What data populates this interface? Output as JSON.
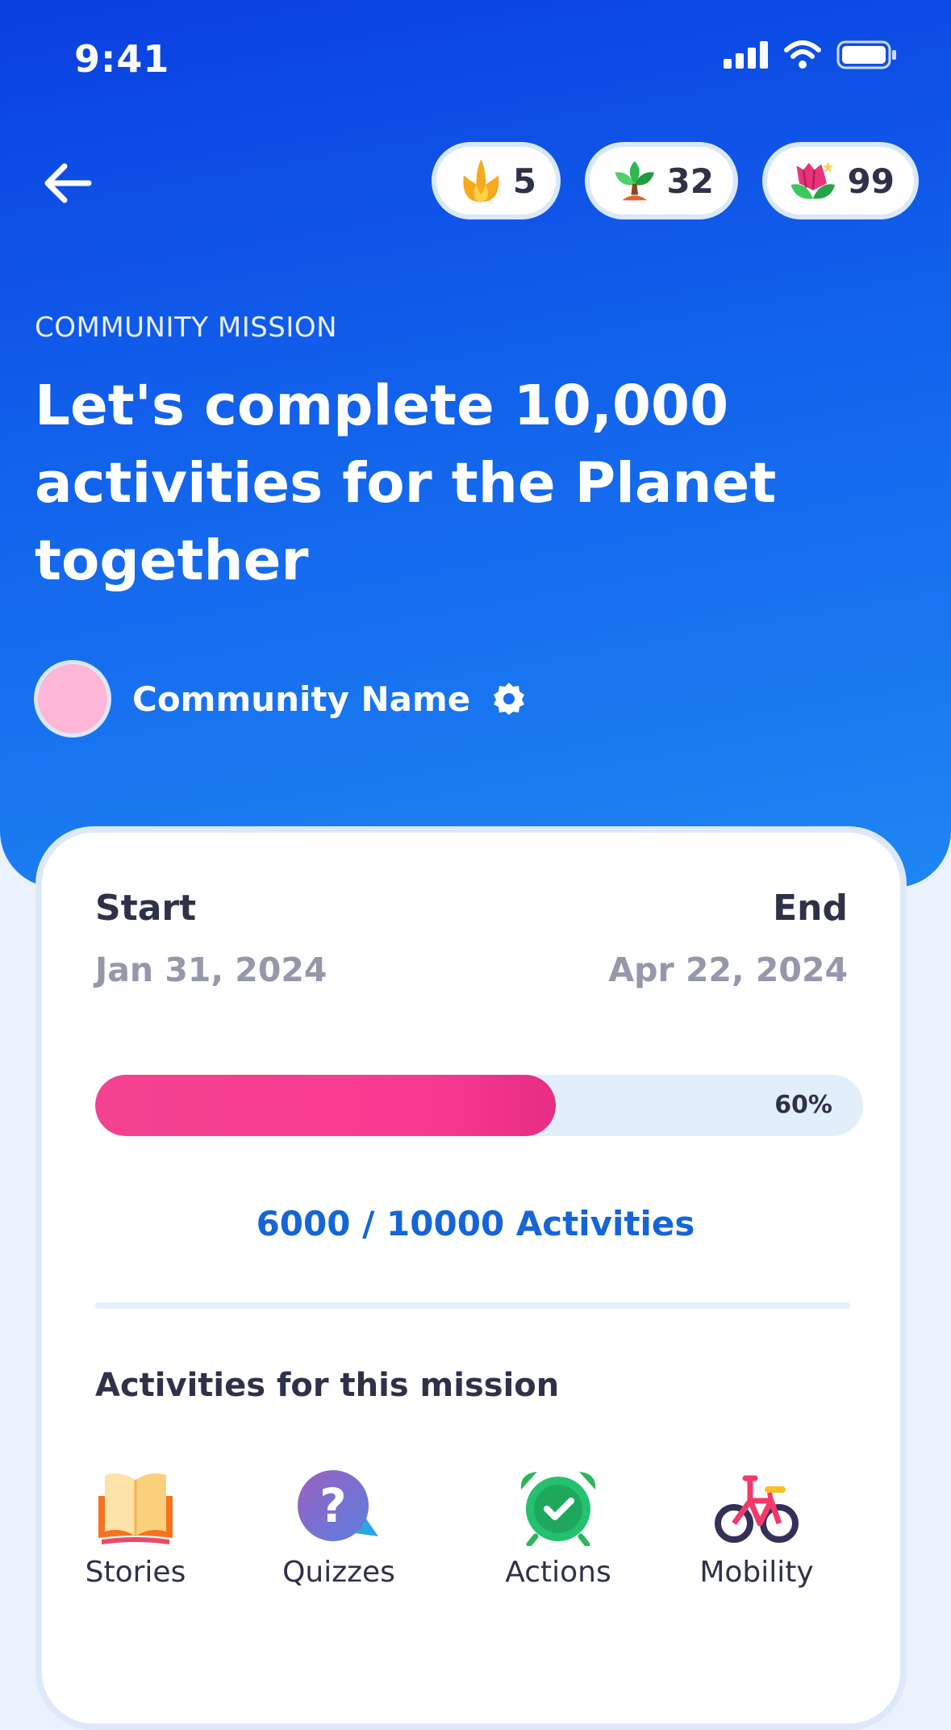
{
  "status_bar": {
    "time": "9:41"
  },
  "header": {
    "back_icon": "arrow-left-icon",
    "currencies": [
      {
        "icon": "seed-icon",
        "value": "5"
      },
      {
        "icon": "tree-icon",
        "value": "32"
      },
      {
        "icon": "flower-icon",
        "value": "99"
      }
    ]
  },
  "mission": {
    "eyebrow": "COMMUNITY MISSION",
    "title": "Let's complete 10,000 activities for the Planet together",
    "community_name": "Community Name",
    "verified_icon": "verified-badge-icon"
  },
  "card": {
    "start_label": "Start",
    "start_date": "Jan 31, 2024",
    "end_label": "End",
    "end_date": "Apr 22, 2024",
    "progress_percent": 60,
    "progress_label": "60%",
    "activity_count": "6000 / 10000 Activities",
    "section_title": "Activities for this mission",
    "activities": [
      {
        "label": "Stories",
        "icon": "book-icon"
      },
      {
        "label": "Quizzes",
        "icon": "question-bubble-icon"
      },
      {
        "label": "Actions",
        "icon": "alarm-clock-icon"
      },
      {
        "label": "Mobility",
        "icon": "bicycle-icon"
      }
    ]
  },
  "colors": {
    "hero_gradient_start": "#0a3fe0",
    "hero_gradient_end": "#1f86f3",
    "progress_fill": "#f93a93",
    "accent_text": "#1565d8",
    "avatar": "#fdb6d6"
  }
}
